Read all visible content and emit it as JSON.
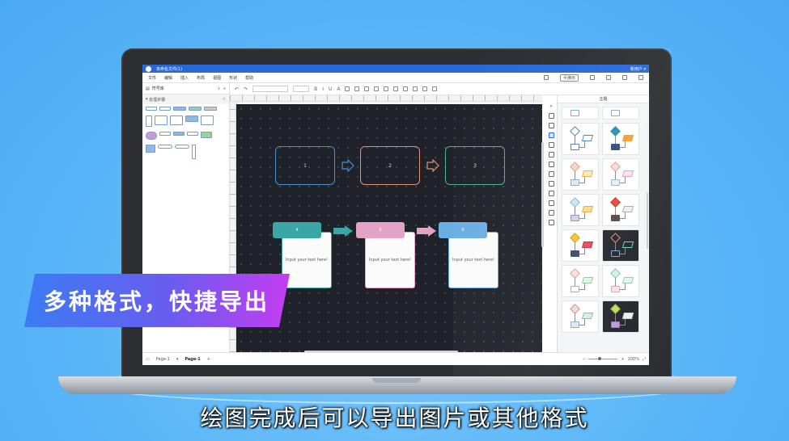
{
  "app": {
    "window_title": "未命名文件(1)",
    "user": "新用户 ▾"
  },
  "menu": {
    "items": [
      "文件",
      "编辑",
      "插入",
      "布局",
      "视图",
      "形状",
      "帮助"
    ],
    "present_label": "⦿演示"
  },
  "left_panel": {
    "title": "符号库",
    "section": "处理步骤"
  },
  "canvas": {
    "nodes": [
      {
        "label": "1",
        "color": "#4b8fd6"
      },
      {
        "label": "2",
        "color": "#e2917a"
      },
      {
        "label": "3",
        "color": "#4fb08a"
      }
    ],
    "cards": [
      {
        "label": "4",
        "head_color": "#3aa6a6",
        "body": "Input your text here!"
      },
      {
        "label": "5",
        "head_color": "#e2a3c7",
        "body": "Input your text here!"
      },
      {
        "label": "6",
        "head_color": "#6aaee6",
        "body": "Input your text here!"
      }
    ]
  },
  "theme_panel": {
    "title": "主题"
  },
  "statusbar": {
    "page_select": "Page-1",
    "active_tab": "Page-1",
    "add": "+",
    "zoom": "100%"
  },
  "overlay": {
    "banner": "多种格式，快捷导出",
    "subtitle": "绘图完成后可以导出图片或其他格式"
  },
  "colors": {
    "accent": "#2a68d8",
    "canvas_bg": "#1f2329",
    "banner_start": "#3a7cf3",
    "banner_end": "#c43df0"
  }
}
